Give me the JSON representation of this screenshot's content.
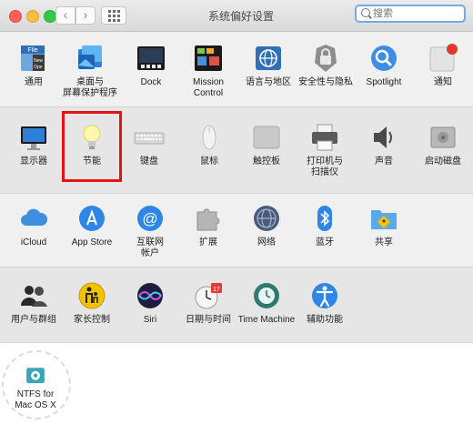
{
  "window": {
    "title": "系统偏好设置",
    "search": {
      "placeholder": "搜索",
      "value": ""
    },
    "nav": {
      "back": "‹",
      "forward": "›"
    }
  },
  "rows": [
    [
      {
        "label": "通用",
        "icon": "general-icon"
      },
      {
        "label": "桌面与\n屏幕保护程序",
        "icon": "desktop-screensaver-icon"
      },
      {
        "label": "Dock",
        "icon": "dock-icon"
      },
      {
        "label": "Mission\nControl",
        "icon": "mission-control-icon"
      },
      {
        "label": "语言与地区",
        "icon": "language-region-icon"
      },
      {
        "label": "安全性与隐私",
        "icon": "security-privacy-icon"
      },
      {
        "label": "Spotlight",
        "icon": "spotlight-icon"
      },
      {
        "label": "通知",
        "icon": "notifications-icon"
      }
    ],
    [
      {
        "label": "显示器",
        "icon": "displays-icon"
      },
      {
        "label": "节能",
        "icon": "energy-saver-icon"
      },
      {
        "label": "键盘",
        "icon": "keyboard-icon"
      },
      {
        "label": "鼠标",
        "icon": "mouse-icon"
      },
      {
        "label": "触控板",
        "icon": "trackpad-icon"
      },
      {
        "label": "打印机与\n扫描仪",
        "icon": "printers-scanners-icon"
      },
      {
        "label": "声音",
        "icon": "sound-icon"
      },
      {
        "label": "启动磁盘",
        "icon": "startup-disk-icon"
      }
    ],
    [
      {
        "label": "iCloud",
        "icon": "icloud-icon"
      },
      {
        "label": "App Store",
        "icon": "app-store-icon"
      },
      {
        "label": "互联网\n帐户",
        "icon": "internet-accounts-icon"
      },
      {
        "label": "扩展",
        "icon": "extensions-icon"
      },
      {
        "label": "网络",
        "icon": "network-icon"
      },
      {
        "label": "蓝牙",
        "icon": "bluetooth-icon"
      },
      {
        "label": "共享",
        "icon": "sharing-icon"
      }
    ],
    [
      {
        "label": "用户与群组",
        "icon": "users-groups-icon"
      },
      {
        "label": "家长控制",
        "icon": "parental-controls-icon"
      },
      {
        "label": "Siri",
        "icon": "siri-icon"
      },
      {
        "label": "日期与时间",
        "icon": "date-time-icon"
      },
      {
        "label": "Time Machine",
        "icon": "time-machine-icon"
      },
      {
        "label": "辅助功能",
        "icon": "accessibility-icon"
      }
    ],
    [
      {
        "label": "NTFS for\nMac OS X",
        "icon": "ntfs-icon"
      }
    ]
  ],
  "clock_badge": "17",
  "highlighted": "节能"
}
